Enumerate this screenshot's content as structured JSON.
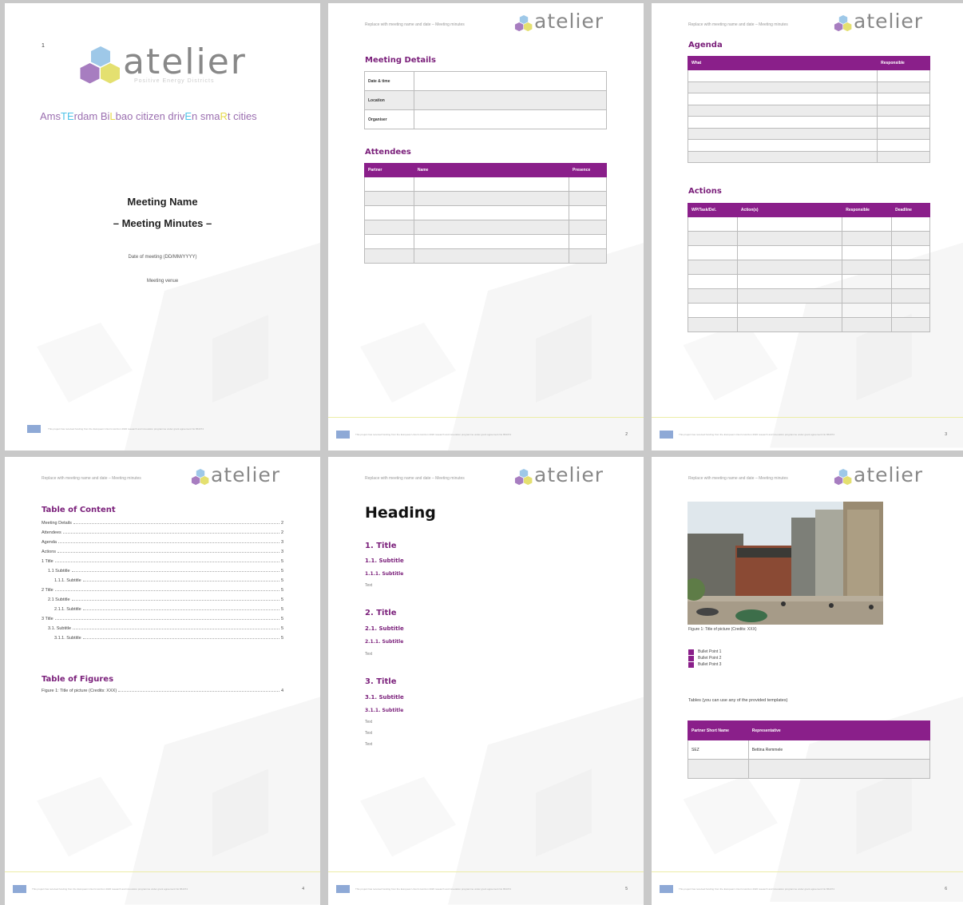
{
  "brand": {
    "name": "atelier",
    "tagline": "Positive Energy Districts",
    "accent": "#8a1f8a"
  },
  "header_text": "Replace with meeting name and date – Meeting minutes",
  "footer_text": "This project has received funding from the European Union's Horizon 2020 research and innovation programme under grant agreement No 864374",
  "cover": {
    "marker": "1",
    "subtitle_parts": [
      {
        "t": "Ams",
        "c": "#9b6fb0"
      },
      {
        "t": "TE",
        "c": "#4fc3e8"
      },
      {
        "t": "rdam Bi",
        "c": "#9b6fb0"
      },
      {
        "t": "L",
        "c": "#e6d84a"
      },
      {
        "t": "bao citizen driv",
        "c": "#9b6fb0"
      },
      {
        "t": "E",
        "c": "#4fc3e8"
      },
      {
        "t": "n sma",
        "c": "#9b6fb0"
      },
      {
        "t": "R",
        "c": "#e6d84a"
      },
      {
        "t": "t cities",
        "c": "#9b6fb0"
      }
    ],
    "title": "Meeting Name",
    "title2": "– Meeting Minutes –",
    "date_label": "Date of meeting (DD/MM/YYYY)",
    "venue_label": "Meeting venue"
  },
  "p2": {
    "details_title": "Meeting Details",
    "details_rows": [
      "Date & time",
      "Location",
      "Organiser"
    ],
    "attendees_title": "Attendees",
    "attendees_cols": [
      "Partner",
      "Name",
      "Presence"
    ],
    "page_num": "2"
  },
  "p3": {
    "agenda_title": "Agenda",
    "agenda_cols": [
      "What",
      "Responsible"
    ],
    "actions_title": "Actions",
    "actions_cols": [
      "WP/Task/Del.",
      "Action(s)",
      "Responsible",
      "Deadline"
    ],
    "page_num": "3"
  },
  "p4": {
    "toc_title": "Table of Content",
    "toc": [
      {
        "t": "Meeting Details",
        "p": "2",
        "i": 0
      },
      {
        "t": "Attendees",
        "p": "2",
        "i": 0
      },
      {
        "t": "Agenda",
        "p": "3",
        "i": 0
      },
      {
        "t": "Actions",
        "p": "3",
        "i": 0
      },
      {
        "t": "1    Title",
        "p": "5",
        "i": 0
      },
      {
        "t": "1.1    Subtitle",
        "p": "5",
        "i": 8
      },
      {
        "t": "1.1.1.    Subtitle",
        "p": "5",
        "i": 16
      },
      {
        "t": "2    Title",
        "p": "5",
        "i": 0
      },
      {
        "t": "2.1    Subtitle",
        "p": "5",
        "i": 8
      },
      {
        "t": "2.1.1.    Subtitle",
        "p": "5",
        "i": 16
      },
      {
        "t": "3    Title",
        "p": "5",
        "i": 0
      },
      {
        "t": "3.1.    Subtitle",
        "p": "5",
        "i": 8
      },
      {
        "t": "3.1.1.    Subtitle",
        "p": "5",
        "i": 16
      }
    ],
    "tof_title": "Table of Figures",
    "tof": [
      {
        "t": "Figure 1: Title of picture (Credits: XXX)",
        "p": "4"
      }
    ],
    "page_num": "4"
  },
  "p5": {
    "heading": "Heading",
    "t1": "1. Title",
    "s1": "1.1.  Subtitle",
    "ss1": "1.1.1. Subtitle",
    "x1": "Text",
    "t2": "2. Title",
    "s2": "2.1.  Subtitle",
    "ss2": "2.1.1. Subtitle",
    "x2": "Text",
    "t3": "3. Title",
    "s3": "3.1.  Subtitle",
    "ss3": "3.1.1. Subtitle",
    "x3": [
      "Text",
      "Text",
      "Text"
    ],
    "page_num": "5"
  },
  "p6": {
    "caption": "Figure 1: Title of picture (Credits: XXX)",
    "bullets": [
      "Bullet Point 1",
      "Bullet Point 2",
      "Bullet Point 3"
    ],
    "tables_note": "Tables (you can use any of the provided templates)",
    "table_cols": [
      "Partner Short Name",
      "Representative"
    ],
    "table_rows": [
      [
        "SEZ",
        "Bettina Remmele"
      ],
      [
        "",
        ""
      ]
    ],
    "page_num": "6"
  }
}
